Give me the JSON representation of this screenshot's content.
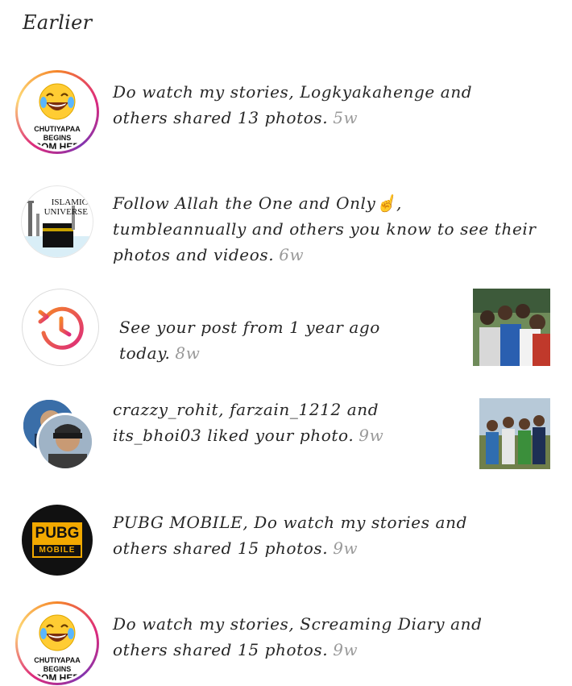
{
  "section": {
    "title": "Earlier"
  },
  "notifications": [
    {
      "text": "Do watch my stories, Logkyakahenge and others shared 13 photos.",
      "time": "5w",
      "avatar": {
        "type": "laugh-emoji",
        "caption_line1": "CHUTIYAPAA BEGINS",
        "caption_line2": "FROM HERE",
        "story_ring": true
      }
    },
    {
      "text": "Follow Allah the One and Only☝️, tumbleannually and others you know to see their photos and videos.",
      "time": "6w",
      "avatar": {
        "type": "islamic-universe",
        "label_line1": "ISLAMIC",
        "label_line2": "UNIVERSE"
      }
    },
    {
      "text": "See your post from 1 year ago today.",
      "time": "8w",
      "avatar": {
        "type": "memory-icon"
      },
      "thumbnail": "group-selfie-photo"
    },
    {
      "text": "crazzy_rohit, farzain_1212 and its_bhoi03 liked your photo.",
      "time": "9w",
      "avatar": {
        "type": "stacked-profiles"
      },
      "thumbnail": "friends-outdoor-photo"
    },
    {
      "text": "PUBG MOBILE, Do watch my stories and others shared 15 photos.",
      "time": "9w",
      "avatar": {
        "type": "pubg",
        "logo_main": "PUBG",
        "logo_sub": "MOBILE"
      }
    },
    {
      "text": "Do watch my stories, Screaming Diary and others shared 15 photos.",
      "time": "9w",
      "avatar": {
        "type": "laugh-emoji",
        "caption_line1": "CHUTIYAPAA BEGINS",
        "caption_line2": "FROM HERE",
        "story_ring": true
      }
    }
  ],
  "colors": {
    "time_gray": "#9a9a9a",
    "text": "#262626",
    "pubg_gold": "#f2a900",
    "memory_gradient_start": "#f58529",
    "memory_gradient_end": "#dd2a7b"
  }
}
